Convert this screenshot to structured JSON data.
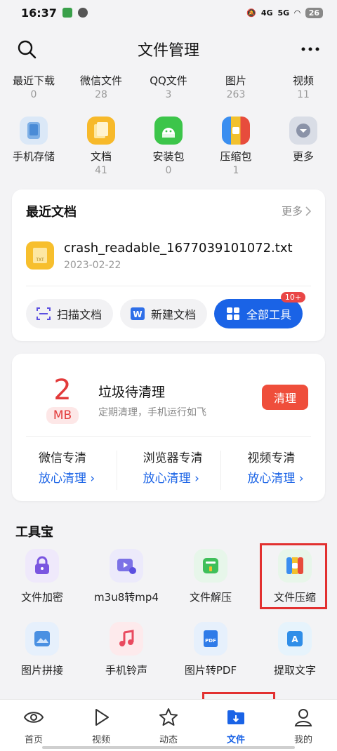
{
  "status_bar": {
    "time": "16:37",
    "signal": "4G",
    "signal2": "5G",
    "battery": "26"
  },
  "header": {
    "title": "文件管理"
  },
  "quick": [
    {
      "label": "最近下载",
      "count": "0"
    },
    {
      "label": "微信文件",
      "count": "28"
    },
    {
      "label": "QQ文件",
      "count": "3"
    },
    {
      "label": "图片",
      "count": "263"
    },
    {
      "label": "视频",
      "count": "11"
    }
  ],
  "categories": [
    {
      "label": "手机存储",
      "count": ""
    },
    {
      "label": "文档",
      "count": "41"
    },
    {
      "label": "安装包",
      "count": "0"
    },
    {
      "label": "压缩包",
      "count": "1"
    },
    {
      "label": "更多",
      "count": ""
    }
  ],
  "recent_docs": {
    "title": "最近文档",
    "more": "更多",
    "file_name": "crash_readable_1677039101072.txt",
    "file_date": "2023-02-22",
    "file_type": "TXT",
    "scan_label": "扫描文档",
    "new_label": "新建文档",
    "all_tools_label": "全部工具",
    "badge": "10+"
  },
  "cleanup": {
    "size": "2",
    "unit": "MB",
    "title": "垃圾待清理",
    "subtitle": "定期清理，手机运行如飞",
    "button": "清理",
    "cols": [
      {
        "title": "微信专清",
        "action": "放心清理"
      },
      {
        "title": "浏览器专清",
        "action": "放心清理"
      },
      {
        "title": "视频专清",
        "action": "放心清理"
      }
    ]
  },
  "tools": {
    "title": "工具宝",
    "items": [
      {
        "label": "文件加密"
      },
      {
        "label": "m3u8转mp4"
      },
      {
        "label": "文件解压"
      },
      {
        "label": "文件压缩"
      },
      {
        "label": "图片拼接"
      },
      {
        "label": "手机铃声"
      },
      {
        "label": "图片转PDF"
      },
      {
        "label": "提取文字"
      }
    ]
  },
  "bottom_nav": [
    {
      "label": "首页"
    },
    {
      "label": "视频"
    },
    {
      "label": "动态"
    },
    {
      "label": "文件",
      "active": true
    },
    {
      "label": "我的"
    }
  ],
  "colors": {
    "accent": "#1a63e6",
    "danger": "#e23a3a",
    "highlight": "#e23030"
  }
}
